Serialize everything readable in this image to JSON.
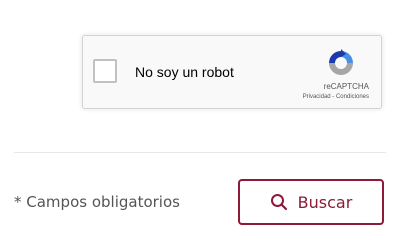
{
  "recaptcha": {
    "checkbox_label": "No soy un robot",
    "brand": "reCAPTCHA",
    "terms": "Privacidad - Condiciones",
    "logo_icon": "recaptcha-logo-icon"
  },
  "form": {
    "required_note": "* Campos obligatorios",
    "search_button_label": "Buscar",
    "search_icon": "search-icon"
  },
  "colors": {
    "accent": "#8c1a38",
    "recaptcha_blue": "#4a90e2",
    "recaptcha_gray": "#a6a6a6"
  }
}
